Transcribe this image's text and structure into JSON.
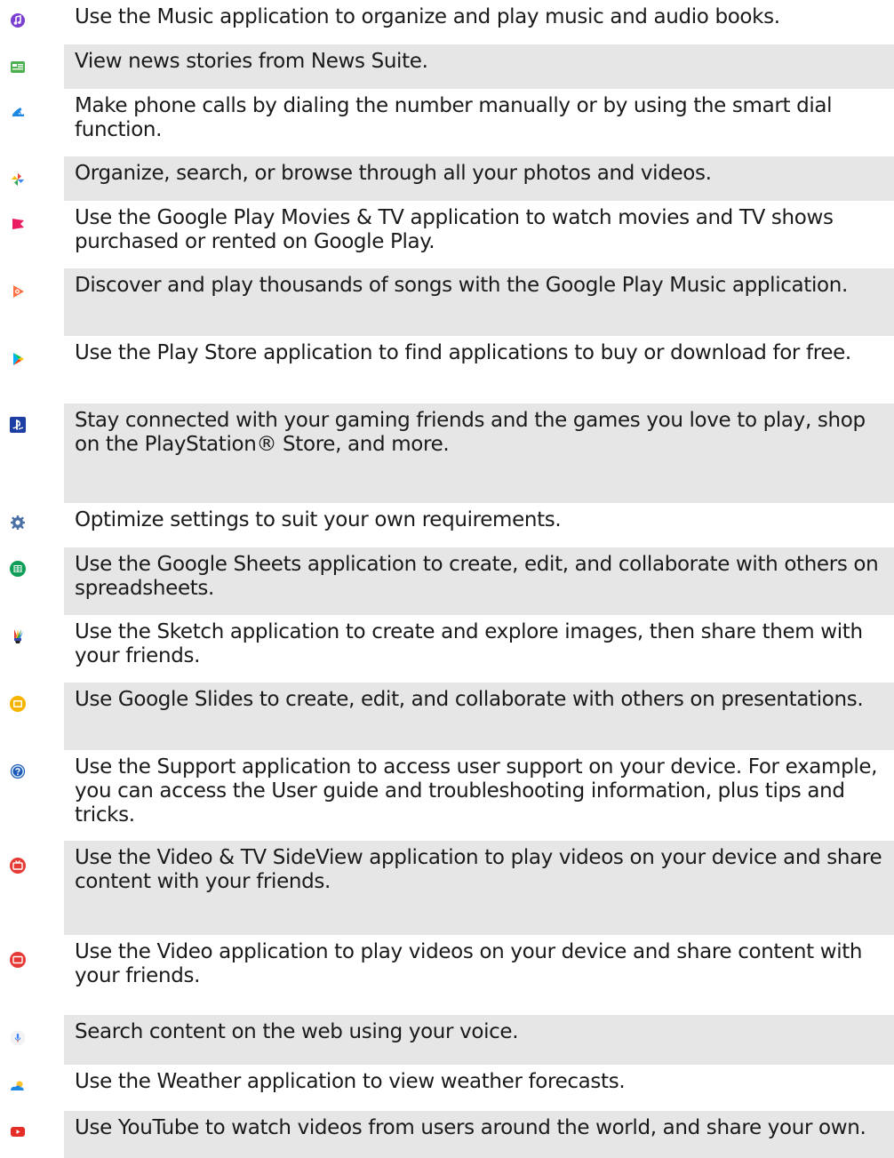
{
  "apps": [
    {
      "icon": "music-icon",
      "description": "Use the Music application to organize and play music and audio books."
    },
    {
      "icon": "news-suite-icon",
      "description": "View news stories from News Suite."
    },
    {
      "icon": "phone-icon",
      "description": "Make phone calls by dialing the number manually or by using the smart dial function."
    },
    {
      "icon": "google-photos-icon",
      "description": "Organize, search, or browse through all your photos and videos."
    },
    {
      "icon": "play-movies-icon",
      "description": "Use the Google Play Movies & TV application to watch movies and TV shows purchased or rented on Google Play."
    },
    {
      "icon": "play-music-icon",
      "description": "Discover and play thousands of songs with the Google Play Music application."
    },
    {
      "icon": "play-store-icon",
      "description": "Use the Play Store application to find applications to buy or download for free."
    },
    {
      "icon": "playstation-icon",
      "description": "Stay connected with your gaming friends and the games you love to play, shop on the PlayStation® Store, and more."
    },
    {
      "icon": "settings-icon",
      "description": "Optimize settings to suit your own requirements."
    },
    {
      "icon": "google-sheets-icon",
      "description": "Use the Google Sheets application to create, edit, and collaborate with others on spreadsheets."
    },
    {
      "icon": "sketch-icon",
      "description": "Use the Sketch application to create and explore images, then share them with your friends."
    },
    {
      "icon": "google-slides-icon",
      "description": "Use Google Slides to create, edit, and collaborate with others on presentations."
    },
    {
      "icon": "support-icon",
      "description": "Use the Support application to access user support on your device. For example, you can access the User guide and troubleshooting information, plus tips and tricks."
    },
    {
      "icon": "video-tv-sideview-icon",
      "description": "Use the Video & TV SideView application to play videos on your device and share content with your friends."
    },
    {
      "icon": "video-icon",
      "description": "Use the Video application to play videos on your device and share content with your friends."
    },
    {
      "icon": "voice-search-icon",
      "description": "Search content on the web using your voice."
    },
    {
      "icon": "weather-icon",
      "description": "Use the Weather application to view weather forecasts."
    },
    {
      "icon": "youtube-icon",
      "description": "Use YouTube to watch videos from users around the world, and share your own."
    }
  ]
}
